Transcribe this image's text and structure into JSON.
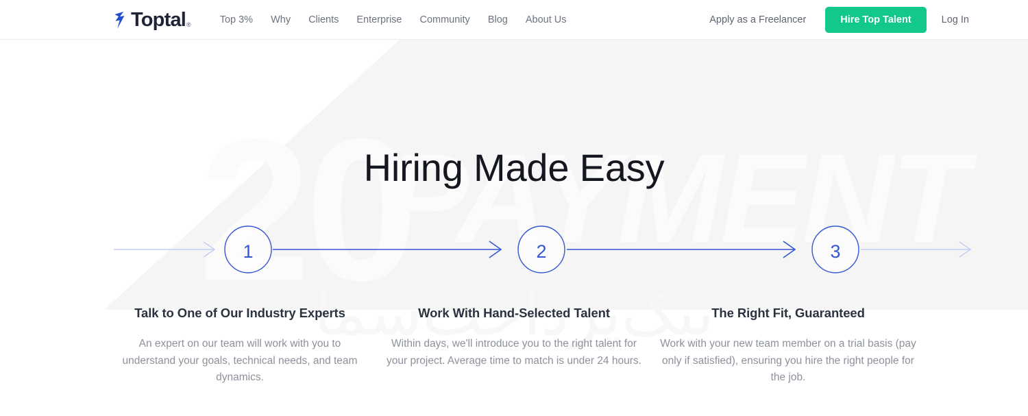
{
  "brand": {
    "name": "Toptal",
    "trademark": "®",
    "logo_icon": "toptal-bolt-icon",
    "logo_color": "#204ecf",
    "wordmark_color": "#1f2437"
  },
  "header": {
    "nav_items": [
      {
        "label": "Top 3%",
        "name": "nav-link-top-3-percent"
      },
      {
        "label": "Why",
        "name": "nav-link-why"
      },
      {
        "label": "Clients",
        "name": "nav-link-clients"
      },
      {
        "label": "Enterprise",
        "name": "nav-link-enterprise"
      },
      {
        "label": "Community",
        "name": "nav-link-community"
      },
      {
        "label": "Blog",
        "name": "nav-link-blog"
      },
      {
        "label": "About Us",
        "name": "nav-link-about-us"
      }
    ],
    "apply_link": "Apply as a Freelancer",
    "cta_label": "Hire Top Talent",
    "cta_color": "#13c98a",
    "login_link": "Log In"
  },
  "hero": {
    "title": "Hiring Made Easy",
    "accent_color": "#3457d5",
    "faded_accent_color": "#c3cdf2",
    "watermark": {
      "number": "20",
      "word": "PAYMENT",
      "subtext": "نیک‌پرداخت‌شما",
      "color": "#f4f4f5"
    },
    "steps": [
      {
        "number": "1",
        "heading": "Talk to One of Our Industry Experts",
        "body": "An expert on our team will work with you to understand your goals, technical needs, and team dynamics."
      },
      {
        "number": "2",
        "heading": "Work With Hand-Selected Talent",
        "body": "Within days, we'll introduce you to the right talent for your project. Average time to match is under 24 hours."
      },
      {
        "number": "3",
        "heading": "The Right Fit, Guaranteed",
        "body": "Work with your new team member on a trial basis (pay only if satisfied), ensuring you hire the right people for the job."
      }
    ]
  }
}
